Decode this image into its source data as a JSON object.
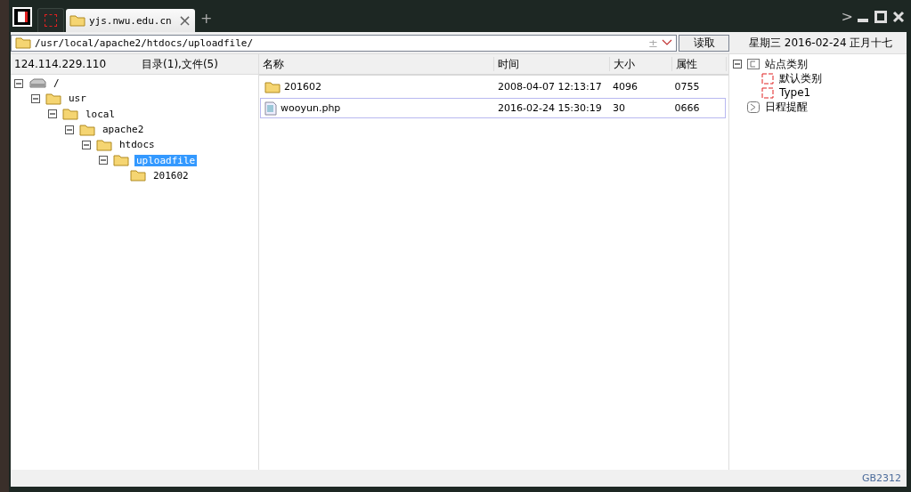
{
  "tab": {
    "label": "yjs.nwu.edu.cn",
    "close": "×",
    "add": "+"
  },
  "window_controls": {
    "next": ">"
  },
  "address": {
    "path": "/usr/local/apache2/htdocs/uploadfile/",
    "plus_minus": "±",
    "button": "读取"
  },
  "date": "星期三 2016-02-24 正月十七",
  "left_header": {
    "host": "124.114.229.110",
    "counts": "目录(1),文件(5)"
  },
  "tree": [
    {
      "kind": "drive",
      "label": "/",
      "expanded": true,
      "selected": false,
      "children": [
        {
          "kind": "folder",
          "label": "usr",
          "expanded": true,
          "selected": false,
          "children": [
            {
              "kind": "folder",
              "label": "local",
              "expanded": true,
              "selected": false,
              "children": [
                {
                  "kind": "folder",
                  "label": "apache2",
                  "expanded": true,
                  "selected": false,
                  "children": [
                    {
                      "kind": "folder",
                      "label": "htdocs",
                      "expanded": true,
                      "selected": false,
                      "children": [
                        {
                          "kind": "folder",
                          "label": "uploadfile",
                          "expanded": true,
                          "selected": true,
                          "children": [
                            {
                              "kind": "folder",
                              "label": "201602",
                              "selected": false
                            }
                          ]
                        }
                      ]
                    }
                  ]
                }
              ]
            }
          ]
        }
      ]
    }
  ],
  "table": {
    "columns": [
      "名称",
      "时间",
      "大小",
      "属性"
    ],
    "rows": [
      {
        "kind": "folder",
        "name": "201602",
        "time": "2008-04-07 12:13:17",
        "size": "4096",
        "attr": "0755",
        "selected": false
      },
      {
        "kind": "file",
        "name": "wooyun.php",
        "time": "2016-02-24 15:30:19",
        "size": "30",
        "attr": "0666",
        "selected": true
      }
    ]
  },
  "side_tree": [
    {
      "kind": "group",
      "label": "站点类别",
      "expanded": true,
      "children": [
        {
          "kind": "category",
          "label": "默认类别"
        },
        {
          "kind": "category",
          "label": "Type1"
        }
      ]
    },
    {
      "kind": "reminder",
      "label": "日程提醒"
    }
  ],
  "status_bar": {
    "encoding": "GB2312"
  }
}
